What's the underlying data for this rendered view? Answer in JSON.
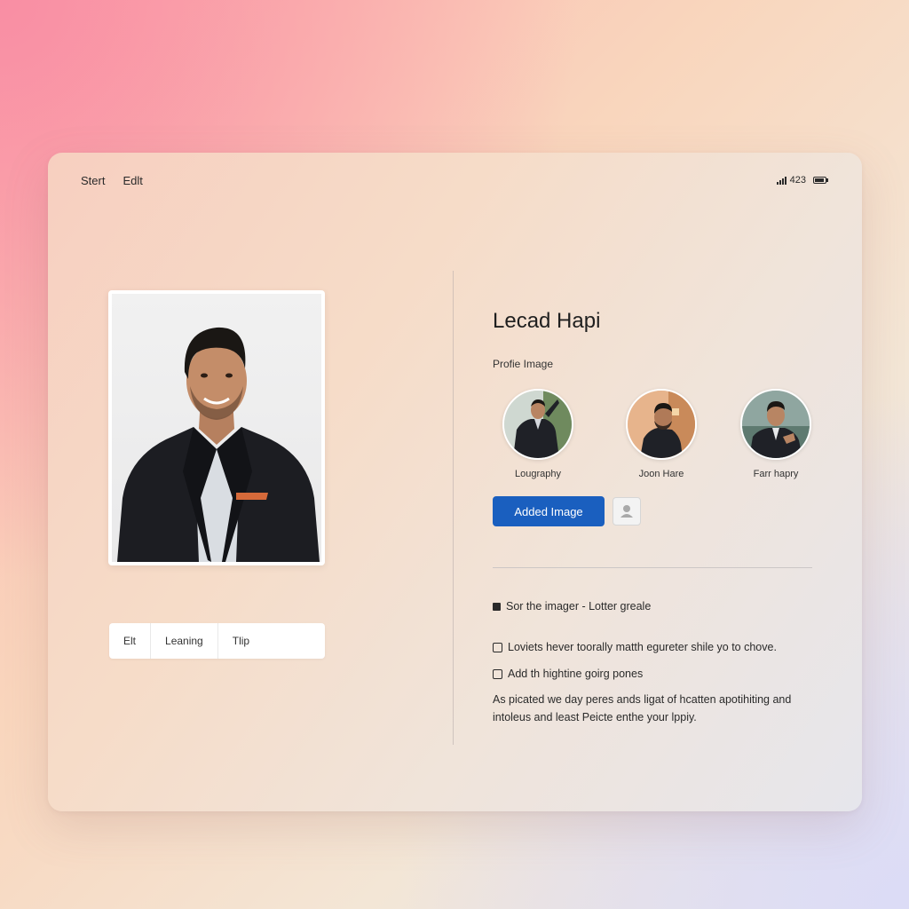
{
  "menu": {
    "items": [
      "Stert",
      "Edlt"
    ]
  },
  "status": {
    "time": "423"
  },
  "profile": {
    "name": "Lecad Hapi",
    "section_label": "Profie Image"
  },
  "thumbnails": [
    {
      "caption": "Lougraphy"
    },
    {
      "caption": "Joon Hare"
    },
    {
      "caption": "Farr hapry"
    }
  ],
  "actions": {
    "add_label": "Added Image"
  },
  "tabs": [
    "Elt",
    "Leaning",
    "Tlip"
  ],
  "info": {
    "heading": "Sor the imager - Lotter greale",
    "item1": "Loviets hever toorally matth egureter shile yo to chove.",
    "item2": "Add th hightine goirg pones",
    "paragraph": "As picated we day peres ands ligat of hcatten apotihiting and intoleus and least Peicte enthe your lppiy."
  },
  "colors": {
    "accent": "#1a5fbf",
    "suit": "#1c1d22",
    "shirt": "#d9dde2"
  }
}
